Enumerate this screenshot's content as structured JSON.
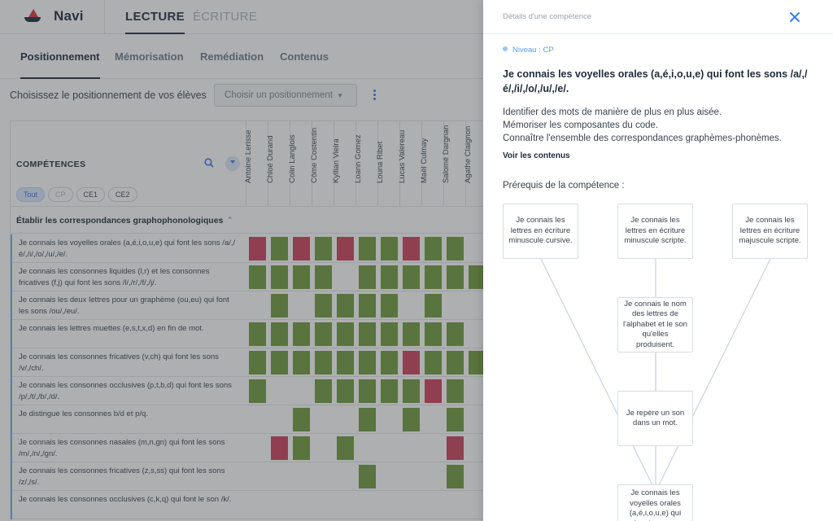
{
  "app": {
    "name": "Navi",
    "main_tabs": [
      {
        "label": "LECTURE",
        "active": true
      },
      {
        "label": "ÉCRITURE",
        "active": false
      }
    ],
    "sub_tabs": [
      {
        "label": "Positionnement",
        "active": true
      },
      {
        "label": "Mémorisation",
        "active": false
      },
      {
        "label": "Remédiation",
        "active": false
      },
      {
        "label": "Contenus",
        "active": false
      }
    ],
    "chooser_label": "Choisissez le positionnement de vos élèves",
    "chooser_placeholder": "Choisir un positionnement"
  },
  "grid": {
    "header": "COMPÉTENCES",
    "filters": [
      {
        "label": "Tout",
        "state": "active"
      },
      {
        "label": "CP",
        "state": "muted"
      },
      {
        "label": "CE1",
        "state": "normal"
      },
      {
        "label": "CE2",
        "state": "normal"
      }
    ],
    "students": [
      "Antoine Lerisse",
      "Chloé Durand",
      "Colin Langlois",
      "Côme Costentin",
      "Kyllian Vieira",
      "Loann Gomez",
      "Louna Ribet",
      "Lucas Valereau",
      "Maël Culmay",
      "Salomé Dargnan",
      "Agathe Claignon"
    ],
    "section_title": "Établir les correspondances graphophonologiques",
    "rows": [
      {
        "label": "Je connais les voyelles orales (a,é,i,o,u,e) qui font les sons /a/,/é/,/i/,/o/,/u/,/e/.",
        "cells": "rgrgrggrgg"
      },
      {
        "label": "Je connais les consonnes liquides (l,r) et les consonnes fricatives (f,j) qui font les sons /l/,/r/,/f/,/j/.",
        "cells": "gggg-gggggg"
      },
      {
        "label": "Je connais les deux lettres pour un graphème (ou,eu) qui font les sons /ou/,/eu/.",
        "cells": "-g-gggg-g"
      },
      {
        "label": "Je connais les lettres muettes (e,s,t,x,d) en fin de mot.",
        "cells": "gggggggggg"
      },
      {
        "label": "Je connais les consonnes fricatives (v,ch) qui font les sons /v/,/ch/.",
        "cells": "gggggggrggg"
      },
      {
        "label": "Je connais les consonnes occlusives (p,t,b,d) qui font les sons /p/,/t/,/b/,/d/.",
        "cells": "g--gggggrg"
      },
      {
        "label": "Je distingue les consonnes b/d et p/q.",
        "cells": "--g--g-g-g"
      },
      {
        "label": "Je connais les consonnes nasales (m,n,gn) qui font les sons /m/,/n/,/gn/.",
        "cells": "-rg-g----r"
      },
      {
        "label": "Je connais les consonnes fricatives (z,s,ss) qui font les sons /z/,/s/.",
        "cells": "-----g---g"
      },
      {
        "label": "Je connais les consonnes occlusives (c,k,q) qui font le son /k/.",
        "cells": ""
      }
    ]
  },
  "panel": {
    "header": "Détails d'une compétence",
    "level": "Niveau : CP",
    "title": "Je connais les voyelles orales (a,é,i,o,u,e) qui font les sons /a/,/é/,/i/,/o/,/u/,/e/.",
    "description": [
      "Identifier des mots de manière de plus en plus aisée.",
      "Mémoriser les composantes du code.",
      "Connaître l'ensemble des correspondances graphèmes-phonèmes."
    ],
    "see_content": "Voir les contenus",
    "prereq_title": "Prérequis de la compétence :",
    "prereq_nodes": [
      "Je connais les lettres en écriture minuscule cursive.",
      "Je connais les lettres en écriture minuscule scripte.",
      "Je connais les lettres en écriture majuscule scripte.",
      "Je connais le nom des lettres de l'alphabet et le son qu'elles produisent.",
      "Je repère un son dans un mot.",
      "Je connais les voyelles orales (a,é,i,o,u,e) qui font les sons"
    ]
  },
  "colors": {
    "accent": "#2f7be5",
    "cell_green": "#6f9a3a",
    "cell_red": "#cd3e58"
  }
}
